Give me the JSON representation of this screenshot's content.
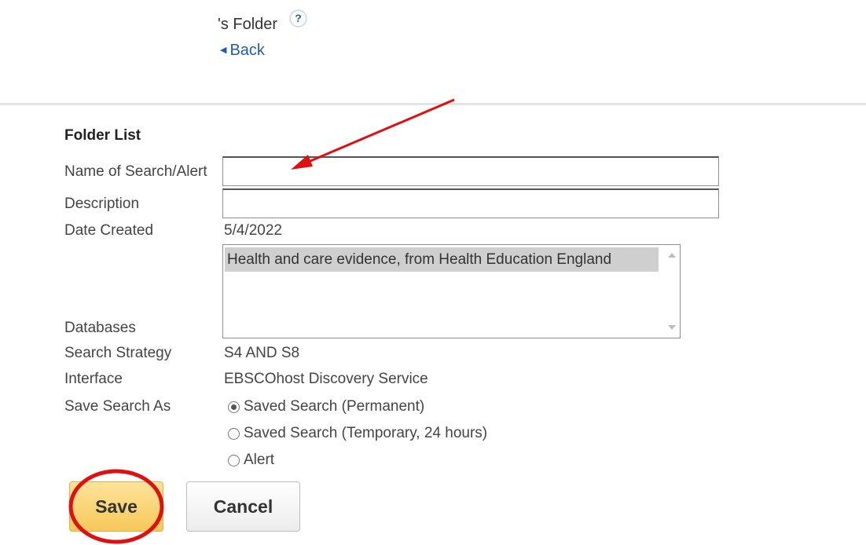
{
  "header": {
    "title": "'s Folder",
    "help_icon_glyph": "?",
    "back_label": "Back",
    "back_icon_glyph": "◀"
  },
  "form": {
    "section_heading": "Folder List",
    "name_label": "Name of Search/Alert",
    "name_value": "",
    "description_label": "Description",
    "description_value": "",
    "date_label": "Date Created",
    "date_value": "5/4/2022",
    "databases_label": "Databases",
    "databases_options": [
      "Health and care evidence, from Health Education England"
    ],
    "strategy_label": "Search Strategy",
    "strategy_value": "S4 AND S8",
    "interface_label": "Interface",
    "interface_value": "EBSCOhost Discovery Service",
    "save_as_label": "Save Search As",
    "save_as_options": [
      {
        "label": "Saved Search (Permanent)",
        "checked": true
      },
      {
        "label": "Saved Search (Temporary, 24 hours)",
        "checked": false
      },
      {
        "label": "Alert",
        "checked": false
      }
    ]
  },
  "buttons": {
    "save_label": "Save",
    "cancel_label": "Cancel"
  },
  "colors": {
    "link": "#1f5fa8",
    "save_button": "#f7c85a",
    "annotation": "#e01010"
  },
  "icons": {
    "help": "help-icon",
    "back": "back-triangle-icon"
  }
}
